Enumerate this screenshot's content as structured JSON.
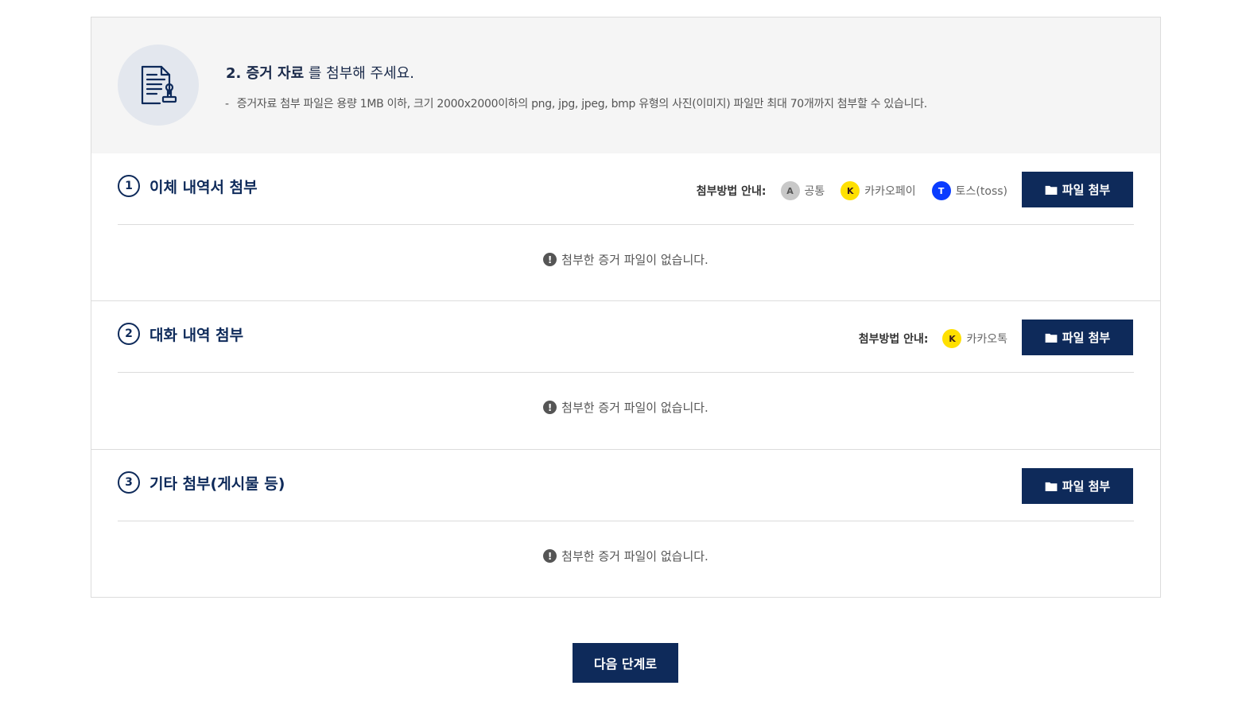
{
  "header": {
    "title_bold": "2. 증거 자료",
    "title_rest": " 를 첨부해 주세요.",
    "desc_dash": "-",
    "desc": "증거자료 첨부 파일은 용량 1MB 이하, 크기 2000x2000이하의 png, jpg, jpeg, bmp 유형의 사진(이미지) 파일만 최대 70개까지 첨부할 수 있습니다.",
    "icon": "document-stamp-icon"
  },
  "guide_label": "첨부방법 안내:",
  "sections": [
    {
      "number": "1",
      "title": "이체 내역서 첨부",
      "guides": [
        {
          "badge": "A",
          "label": "공통",
          "badge_bg": "#c8c8c8",
          "badge_fg": "#555555"
        },
        {
          "badge": "K",
          "label": "카카오페이",
          "badge_bg": "#ffe000",
          "badge_fg": "#3a1d1d"
        },
        {
          "badge": "T",
          "label": "토스(toss)",
          "badge_bg": "#0a3cff",
          "badge_fg": "#ffffff"
        }
      ],
      "button": "파일 첨부",
      "empty": "첨부한 증거 파일이 없습니다."
    },
    {
      "number": "2",
      "title": "대화 내역 첨부",
      "guides": [
        {
          "badge": "K",
          "label": "카카오톡",
          "badge_bg": "#ffe000",
          "badge_fg": "#3a1d1d"
        }
      ],
      "button": "파일 첨부",
      "empty": "첨부한 증거 파일이 없습니다."
    },
    {
      "number": "3",
      "title": "기타 첨부(게시물 등)",
      "guides": [],
      "button": "파일 첨부",
      "empty": "첨부한 증거 파일이 없습니다."
    }
  ],
  "next_button": "다음 단계로",
  "colors": {
    "primary": "#0e2a5a",
    "header_bg": "#f5f5f5",
    "border": "#dcdcdc"
  }
}
